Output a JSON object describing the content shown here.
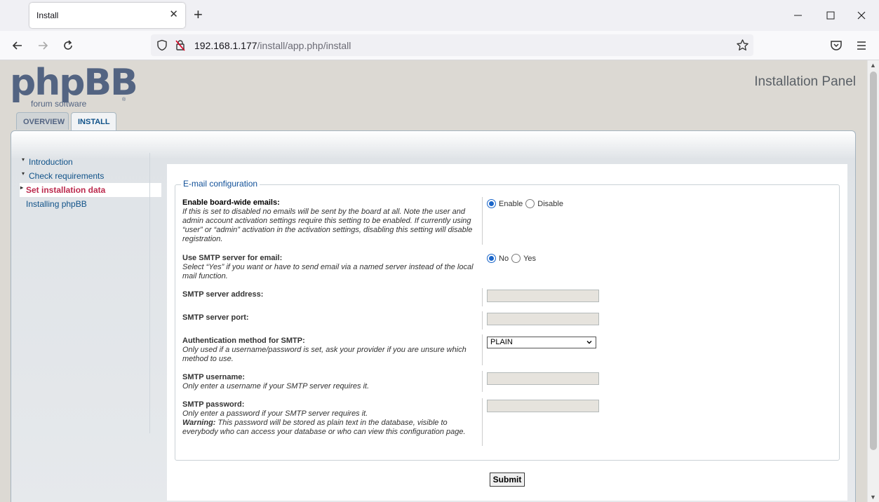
{
  "browser": {
    "tab_title": "Install",
    "tab_close": "✕",
    "new_tab": "+",
    "url_host": "192.168.1.177",
    "url_path": "/install/app.php/install"
  },
  "header": {
    "logo_text": "phpBB",
    "logo_sub": "forum  software",
    "logo_reg": "®",
    "panel_title": "Installation Panel"
  },
  "tabs": [
    {
      "label": "OVERVIEW"
    },
    {
      "label": "INSTALL"
    }
  ],
  "menu": [
    {
      "label": "Introduction"
    },
    {
      "label": "Check requirements"
    },
    {
      "label": "Set installation data"
    },
    {
      "label": "Installing phpBB"
    }
  ],
  "form": {
    "legend": "E-mail configuration",
    "board_emails": {
      "title": "Enable board-wide emails:",
      "explain": "If this is set to disabled no emails will be sent by the board at all. Note the user and admin account activation settings require this setting to be enabled. If currently using “user” or “admin” activation in the activation settings, disabling this setting will disable registration.",
      "opt1": "Enable",
      "opt2": "Disable"
    },
    "smtp": {
      "title": "Use SMTP server for email:",
      "explain": "Select “Yes” if you want or have to send email via a named server instead of the local mail function.",
      "opt1": "No",
      "opt2": "Yes"
    },
    "smtp_host": {
      "title": "SMTP server address:"
    },
    "smtp_port": {
      "title": "SMTP server port:"
    },
    "smtp_auth": {
      "title": "Authentication method for SMTP:",
      "explain": "Only used if a username/password is set, ask your provider if you are unsure which method to use.",
      "value": "PLAIN"
    },
    "smtp_user": {
      "title": "SMTP username:",
      "explain": "Only enter a username if your SMTP server requires it."
    },
    "smtp_pass": {
      "title": "SMTP password:",
      "explain": "Only enter a password if your SMTP server requires it.",
      "warning_label": "Warning:",
      "warning_text": " This password will be stored as plain text in the database, visible to everybody who can access your database or who can view this configuration page."
    },
    "submit_label": "Submit"
  }
}
